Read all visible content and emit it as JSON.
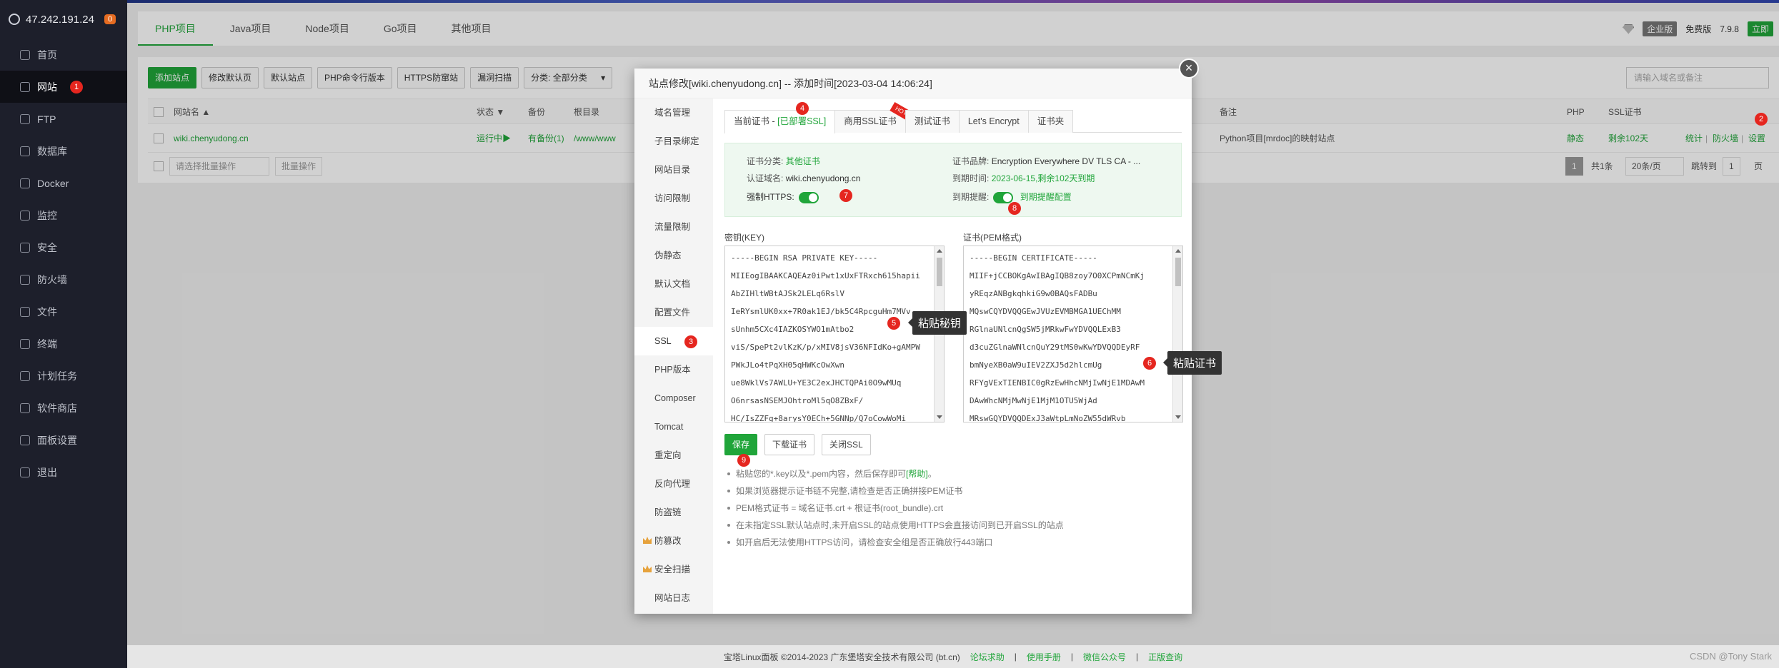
{
  "sidebar": {
    "ip": "47.242.191.24",
    "badge": "0",
    "site_badge": "1",
    "items": [
      {
        "label": "首页",
        "icon": "home-icon"
      },
      {
        "label": "网站",
        "icon": "globe-icon"
      },
      {
        "label": "FTP",
        "icon": "ftp-icon"
      },
      {
        "label": "数据库",
        "icon": "database-icon"
      },
      {
        "label": "Docker",
        "icon": "docker-icon"
      },
      {
        "label": "监控",
        "icon": "monitor-icon"
      },
      {
        "label": "安全",
        "icon": "shield-icon"
      },
      {
        "label": "防火墙",
        "icon": "firewall-icon"
      },
      {
        "label": "文件",
        "icon": "folder-icon"
      },
      {
        "label": "终端",
        "icon": "terminal-icon"
      },
      {
        "label": "计划任务",
        "icon": "calendar-icon"
      },
      {
        "label": "软件商店",
        "icon": "store-icon"
      },
      {
        "label": "面板设置",
        "icon": "settings-icon"
      },
      {
        "label": "退出",
        "icon": "logout-icon"
      }
    ]
  },
  "project_tabs": [
    "PHP项目",
    "Java项目",
    "Node项目",
    "Go项目",
    "其他项目"
  ],
  "topright": {
    "edition": "企业版",
    "free": "免费版",
    "version": "7.9.8",
    "upgrade": "立即"
  },
  "toolbar": {
    "buttons": [
      "添加站点",
      "修改默认页",
      "默认站点",
      "PHP命令行版本",
      "HTTPS防窜站",
      "漏洞扫描"
    ],
    "category": "分类: 全部分类",
    "search_placeholder": "请输入域名或备注"
  },
  "table": {
    "headers": {
      "name": "网站名 ▲",
      "status": "状态 ▼",
      "backup": "备份",
      "root": "根目录",
      "note": "备注",
      "php": "PHP",
      "ssl": "SSL证书"
    },
    "row": {
      "name": "wiki.chenyudong.cn",
      "status": "运行中▶",
      "backup": "有备份(1)",
      "root": "/www/www",
      "note": "Python项目[mrdoc]的映射站点",
      "php": "静态",
      "ssl": "剩余102天",
      "actions": [
        "统计",
        "防火墙",
        "设置"
      ]
    },
    "footer": {
      "batch": "请选择批量操作",
      "batch_btn": "批量操作",
      "page": "1",
      "total": "共1条",
      "per_page": "20条/页",
      "jump_label": "跳转到",
      "jump_value": "1",
      "page_unit": "页"
    }
  },
  "modal": {
    "title": "站点修改[wiki.chenyudong.cn] -- 添加时间[2023-03-04 14:06:24]",
    "menu": [
      "域名管理",
      "子目录绑定",
      "网站目录",
      "访问限制",
      "流量限制",
      "伪静态",
      "默认文档",
      "配置文件",
      "SSL",
      "PHP版本",
      "Composer",
      "Tomcat",
      "重定向",
      "反向代理",
      "防盗链",
      "防篡改",
      "安全扫描",
      "网站日志"
    ],
    "ssl_tabs": {
      "current": "当前证书 - ",
      "current_status": "[已部署SSL]",
      "commercial": "商用SSL证书",
      "hot": "HOT",
      "test": "测试证书",
      "letsencrypt": "Let's Encrypt",
      "folder": "证书夹"
    },
    "info": {
      "type_label": "证书分类:",
      "type_value": "其他证书",
      "brand_label": "证书品牌:",
      "brand_value": "Encryption Everywhere DV TLS CA - ...",
      "domain_label": "认证域名:",
      "domain_value": "wiki.chenyudong.cn",
      "expire_label": "到期时间:",
      "expire_value": "2023-06-15,剩余102天到期",
      "force_https": "强制HTTPS:",
      "remind_label": "到期提醒:",
      "remind_link": "到期提醒配置"
    },
    "key_label": "密钥(KEY)",
    "cert_label": "证书(PEM格式)",
    "key_lines": [
      "-----BEGIN RSA PRIVATE KEY-----",
      "MIIEogIBAAKCAQEAz0iPwt1xUxFTRxch615hapii",
      "AbZIHltWBtAJSk2LELq6RslV",
      "IeRYsmlUK0xx+7R0ak1EJ/bk5C4RpcguHm7MVv",
      "sUnhm5CXc4IAZKOSYWO1mAtbo2",
      "viS/SpePt2vlKzK/p/xMIV8jsV36NFIdKo+gAMPW",
      "PWkJLo4tPqXH05qHWKcOwXwn",
      "ue8WklVs7AWLU+YE3C2exJHCTQPAi0O9wMUq",
      "O6nrsasNSEMJOhtroMl5qO8ZBxF/",
      "HC/IsZZFg+8arysY0ECh+5GNNp/Q7oCowWoMi"
    ],
    "cert_lines": [
      "-----BEGIN CERTIFICATE-----",
      "MIIF+jCCBOKgAwIBAgIQB8zoy7O0XCPmNCmKj",
      "yREqzANBgkqhkiG9w0BAQsFADBu",
      "MQswCQYDVQQGEwJVUzEVMBMGA1UEChMM",
      "RGlnaUNlcnQgSW5jMRkwFwYDVQQLExB3",
      "d3cuZGlnaWNlcnQuY29tMS0wKwYDVQQDEyRF",
      "bmNyeXB0aW9uIEV2ZXJ5d2hlcmUg",
      "RFYgVExTIENBIC0gRzEwHhcNMjIwNjE1MDAwM",
      "DAwWhcNMjMwNjE1MjM1OTU5WjAd",
      "MRswGQYDVQQDExJ3aWtpLmNoZW55dWRvb"
    ],
    "tip_key": "粘贴秘钥",
    "tip_cert": "粘贴证书",
    "save": "保存",
    "download": "下载证书",
    "close_ssl": "关闭SSL",
    "notes": [
      "粘贴您的*.key以及*.pem内容，然后保存即可",
      "如果浏览器提示证书链不完整,请检查是否正确拼接PEM证书",
      "PEM格式证书 = 域名证书.crt + 根证书(root_bundle).crt",
      "在未指定SSL默认站点时,未开启SSL的站点使用HTTPS会直接访问到已开启SSL的站点",
      "如开启后无法使用HTTPS访问，请检查安全组是否正确放行443端口"
    ],
    "help_link": "[帮助]",
    "markers": [
      "3",
      "4",
      "5",
      "6",
      "7",
      "8",
      "9"
    ]
  },
  "footer": {
    "copyright": "宝塔Linux面板 ©2014-2023 广东堡塔安全技术有限公司 (bt.cn)",
    "links": [
      "论坛求助",
      "使用手册",
      "微信公众号",
      "正版查询"
    ],
    "watermark": "CSDN @Tony Stark",
    "marker2": "2"
  }
}
